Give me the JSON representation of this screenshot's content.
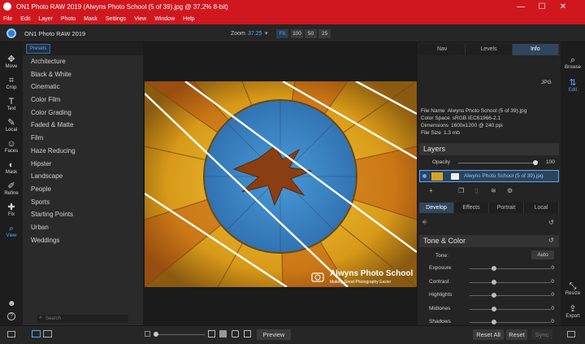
{
  "window": {
    "title": "ON1 Photo RAW 2019 (Alwyns Photo School (5 of 39).jpg @ 37.2% 8-bit)",
    "minimize": "—",
    "maximize": "☐",
    "close": "✕"
  },
  "menu": [
    "File",
    "Edit",
    "Layer",
    "Photo",
    "Mask",
    "Settings",
    "View",
    "Window",
    "Help"
  ],
  "app": {
    "name": "ON1 Photo RAW 2019",
    "zoom_label": "Zoom",
    "zoom_value": "37.25",
    "zoom_buttons": [
      "Fit",
      "100",
      "50",
      "25"
    ]
  },
  "tools": [
    {
      "label": "Move",
      "icon": "move-icon",
      "glyph": "✥"
    },
    {
      "label": "Crop",
      "icon": "crop-icon",
      "glyph": "⌗"
    },
    {
      "label": "Text",
      "icon": "text-icon",
      "glyph": "T"
    },
    {
      "label": "Local",
      "icon": "brush-icon",
      "glyph": "✎"
    },
    {
      "label": "Faces",
      "icon": "face-icon",
      "glyph": "☺"
    },
    {
      "label": "Mask",
      "icon": "mask-icon",
      "glyph": "◐"
    },
    {
      "label": "Refine",
      "icon": "refine-icon",
      "glyph": "✐"
    },
    {
      "label": "Fix",
      "icon": "fix-icon",
      "glyph": "✚"
    },
    {
      "label": "View",
      "icon": "view-icon",
      "glyph": "⌕"
    }
  ],
  "presets": {
    "tab": "Presets",
    "items": [
      "Architecture",
      "Black & White",
      "Cinematic",
      "Color Film",
      "Color Grading",
      "Faded & Matte",
      "Film",
      "Haze Reducing",
      "Hipster",
      "Landscape",
      "People",
      "Sports",
      "Starting Points",
      "Urban",
      "Weddings"
    ],
    "search_placeholder": "Search"
  },
  "photo": {
    "watermark_title": "Alwyns Photo School",
    "watermark_sub": "Making Great Photography Easier"
  },
  "panel": {
    "tabs": [
      "Nav",
      "Levels",
      "Info"
    ],
    "format": "JPG",
    "info": [
      {
        "k": "File Name",
        "v": "Alwyns Photo School (5 of 39).jpg"
      },
      {
        "k": "Color Space",
        "v": "sRGB IEC61966-2.1"
      },
      {
        "k": "Dimensions",
        "v": "1600x1200 @ 240 ppi"
      },
      {
        "k": "File Size",
        "v": "1.3 mb"
      }
    ],
    "layers_title": "Layers",
    "opacity_label": "Opacity",
    "opacity_value": "100",
    "opacity_fraction": 1.0,
    "layer_name": "Alwyns Photo School (5 of 39).jpg",
    "develop_tabs": [
      "Develop",
      "Effects",
      "Portrait",
      "Local"
    ],
    "tone_title": "Tone & Color",
    "tone_label": "Tone:",
    "auto_label": "Auto",
    "sliders": [
      {
        "name": "Exposure",
        "value": "0"
      },
      {
        "name": "Contrast",
        "value": "0"
      },
      {
        "name": "Highlights",
        "value": "0"
      },
      {
        "name": "Midtones",
        "value": "0"
      },
      {
        "name": "Shadows",
        "value": "0"
      }
    ]
  },
  "right_tools": [
    {
      "label": "Browse",
      "icon": "browse-icon",
      "glyph": "⌕"
    },
    {
      "label": "Edit",
      "icon": "edit-icon",
      "glyph": "⇅"
    },
    {
      "label": "Resize",
      "icon": "resize-icon",
      "glyph": "⤡"
    },
    {
      "label": "Export",
      "icon": "export-icon",
      "glyph": "⇪"
    }
  ],
  "bottom": {
    "preview": "Preview",
    "reset_all": "Reset All",
    "reset": "Reset",
    "sync": "Sync"
  },
  "colors": {
    "accent": "#58a8ff",
    "titlebar": "#d0171f",
    "balloon_yellow": "#e8b01a",
    "balloon_blue": "#3a88c8"
  }
}
